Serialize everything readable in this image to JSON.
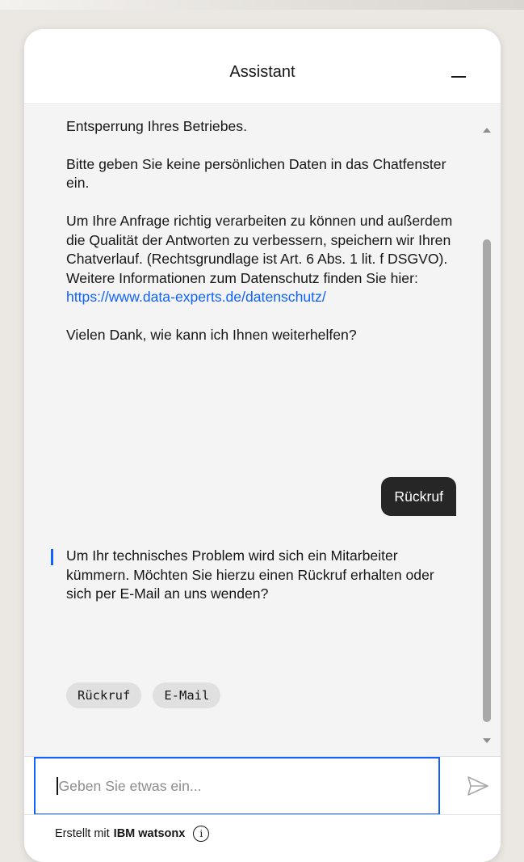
{
  "header": {
    "title": "Assistant",
    "minimize_icon": "minimize-icon"
  },
  "conversation": {
    "welcome_paragraphs": [
      "beantworten kann. Gerne helfe ich Ihnen bereits jetzt bei der Entsperrung Ihres Betriebes.",
      "Bitte geben Sie keine persönlichen Daten in das Chatfenster ein.",
      "Um Ihre Anfrage richtig verarbeiten zu können und außerdem die Qualität der Antworten zu verbessern, speichern wir Ihren Chatverlauf. (Rechtsgrundlage ist Art. 6 Abs. 1 lit. f DSGVO). Weitere Informationen zum Datenschutz finden Sie hier:",
      "Vielen Dank, wie kann ich Ihnen weiterhelfen?"
    ],
    "privacy_link": "https://www.data-experts.de/datenschutz/",
    "user_message": "Rückruf",
    "bot_reply": "Um Ihr technisches Problem wird sich ein Mitarbeiter kümmern. Möchten Sie hierzu einen Rückruf erhalten oder sich per E-Mail an uns wenden?",
    "quick_replies": [
      "Rückruf",
      "E-Mail"
    ]
  },
  "input": {
    "placeholder": "Geben Sie etwas ein...",
    "value": "",
    "send_icon": "send-icon"
  },
  "footer": {
    "prefix": "Erstellt mit",
    "brand": "IBM watsonx",
    "info_icon": "info-icon",
    "info_glyph": "i"
  },
  "colors": {
    "accent": "#0f62fe",
    "user_bubble": "#262626",
    "chat_background": "#f4f4f4",
    "chip_background": "#e0e0e0"
  }
}
